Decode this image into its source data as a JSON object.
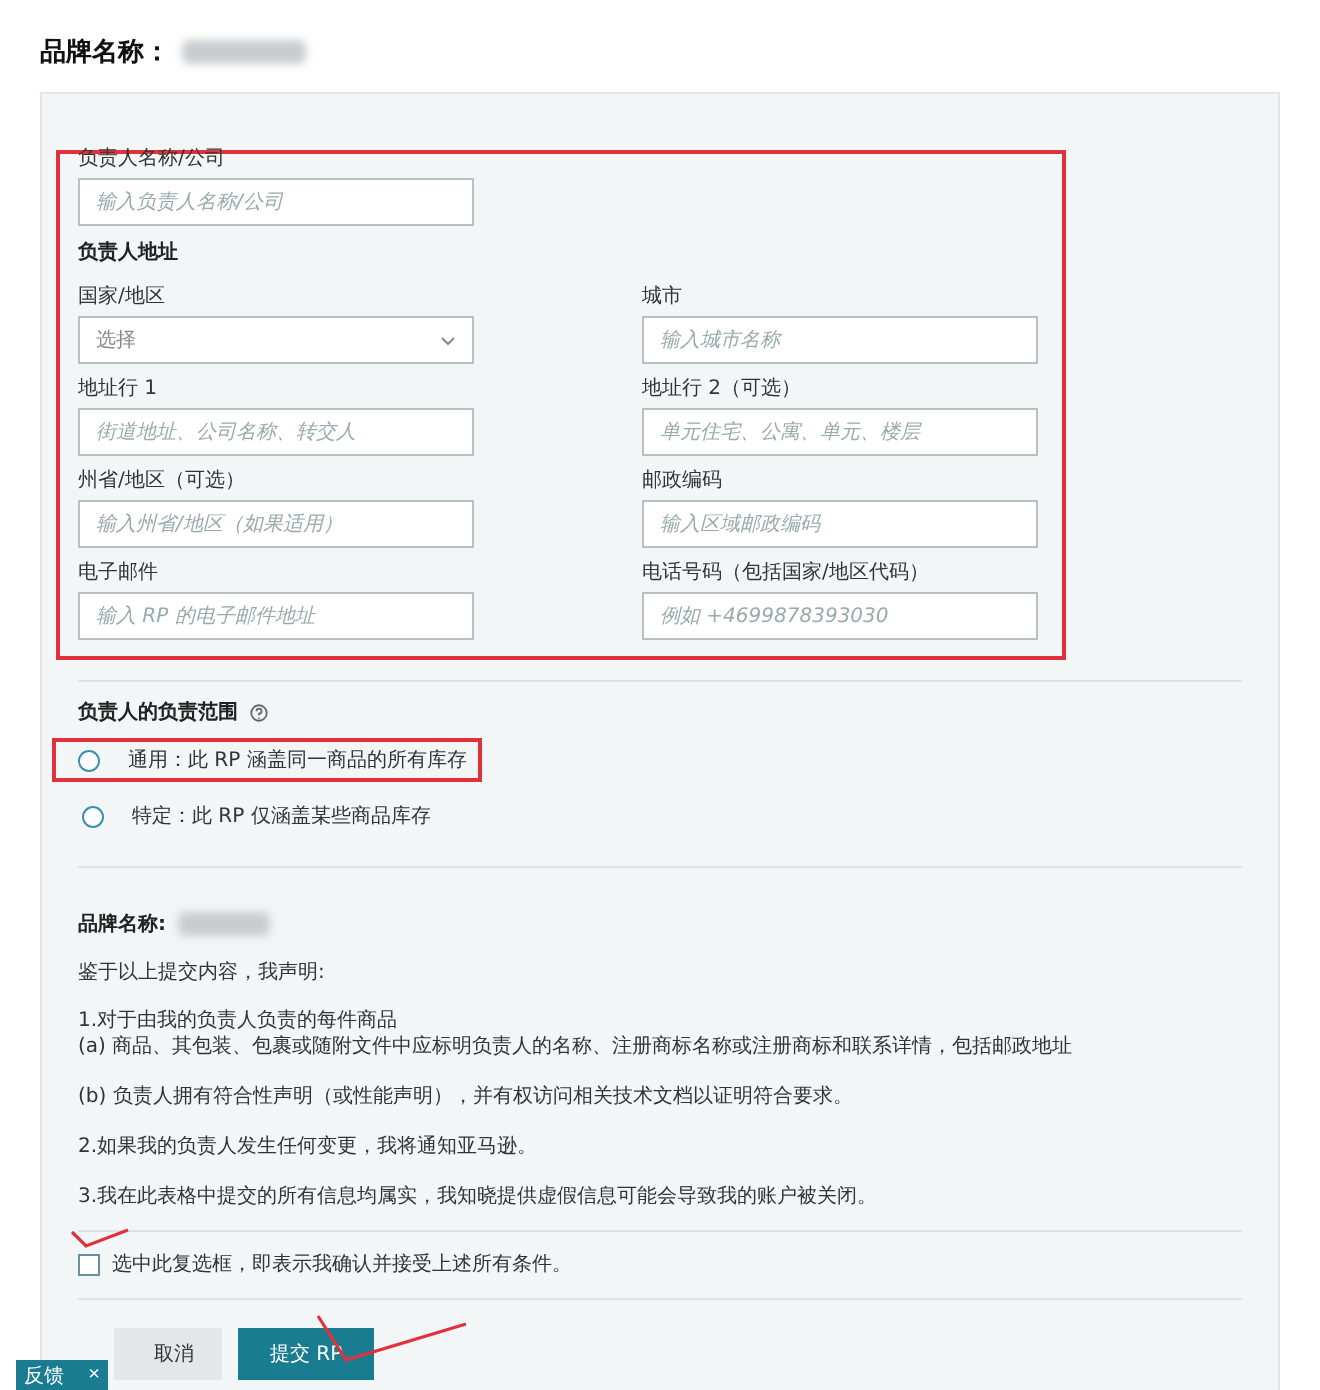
{
  "page_title": "品牌名称：",
  "form": {
    "name_field": {
      "label": "负责人名称/公司",
      "placeholder": "输入负责人名称/公司"
    },
    "address_heading": "负责人地址",
    "fields": [
      {
        "kind": "select",
        "label": "国家/地区",
        "placeholder": "选择"
      },
      {
        "kind": "text",
        "label": "城市",
        "placeholder": "输入城市名称"
      },
      {
        "kind": "text",
        "label": "地址行 1",
        "placeholder": "街道地址、公司名称、转交人"
      },
      {
        "kind": "text",
        "label": "地址行 2（可选）",
        "placeholder": "单元住宅、公寓、单元、楼层"
      },
      {
        "kind": "text",
        "label": "州省/地区（可选）",
        "placeholder": "输入州省/地区（如果适用）"
      },
      {
        "kind": "text",
        "label": "邮政编码",
        "placeholder": "输入区域邮政编码"
      },
      {
        "kind": "text",
        "label": "电子邮件",
        "placeholder": "输入 RP 的电子邮件地址"
      },
      {
        "kind": "text",
        "label": "电话号码（包括国家/地区代码）",
        "placeholder": "例如 +4699878393030"
      }
    ]
  },
  "scope": {
    "heading": "负责人的负责范围",
    "options": [
      {
        "label": "通用：此 RP 涵盖同一商品的所有库存",
        "selected": false
      },
      {
        "label": "特定：此 RP 仅涵盖某些商品库存",
        "selected": false
      }
    ]
  },
  "declaration": {
    "brand_label": "品牌名称:",
    "intro": "鉴于以上提交内容，我声明:",
    "paragraphs": [
      [
        "1.对于由我的负责人负责的每件商品",
        "(a) 商品、其包装、包裹或随附文件中应标明负责人的名称、注册商标名称或注册商标和联系详情，包括邮政地址"
      ],
      [
        "(b) 负责人拥有符合性声明（或性能声明），并有权访问相关技术文档以证明符合要求。"
      ],
      [
        "2.如果我的负责人发生任何变更，我将通知亚马逊。"
      ],
      [
        "3.我在此表格中提交的所有信息均属实，我知晓提供虚假信息可能会导致我的账户被关闭。"
      ]
    ]
  },
  "agreement": {
    "label": "选中此复选框，即表示我确认并接受上述所有条件。",
    "checked": false
  },
  "buttons": [
    {
      "kind": "secondary",
      "label": "取消"
    },
    {
      "kind": "primary",
      "label": "提交 RP"
    }
  ],
  "feedback_tab": {
    "label": "反馈",
    "close": "×"
  }
}
